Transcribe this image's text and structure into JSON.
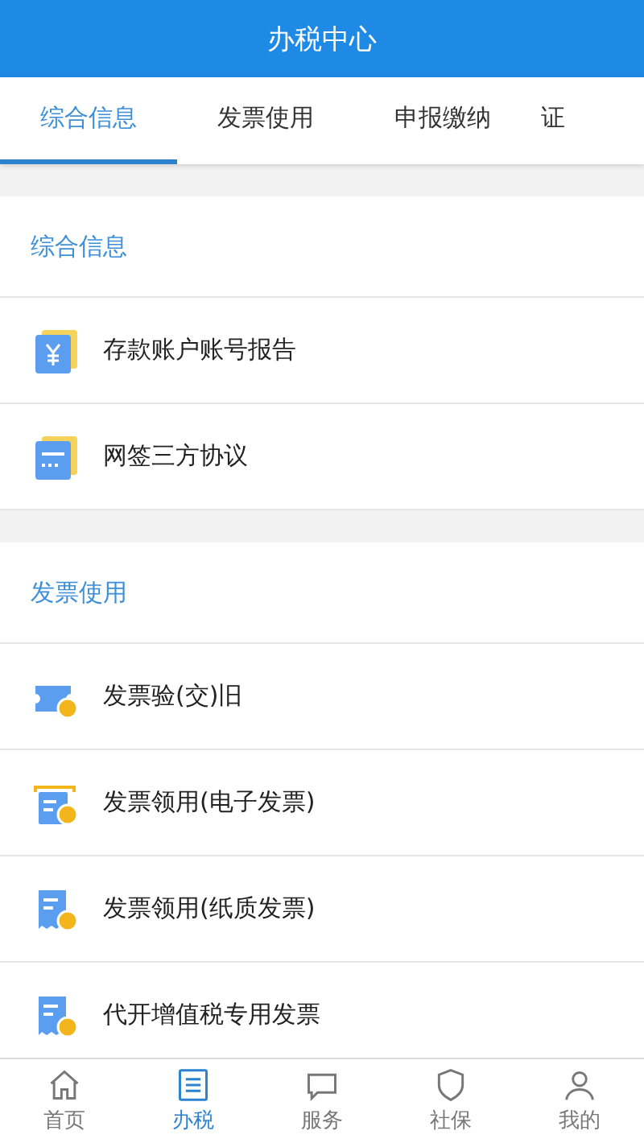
{
  "header": {
    "title": "办税中心"
  },
  "tabs": [
    {
      "label": "综合信息",
      "selected": true
    },
    {
      "label": "发票使用",
      "selected": false
    },
    {
      "label": "申报缴纳",
      "selected": false
    },
    {
      "label": "证",
      "selected": false
    }
  ],
  "sections": [
    {
      "title": "综合信息",
      "items": [
        {
          "label": "存款账户账号报告",
          "kind": "yuan"
        },
        {
          "label": "网签三方协议",
          "kind": "card"
        }
      ]
    },
    {
      "title": "发票使用",
      "items": [
        {
          "label": "发票验(交)旧",
          "kind": "ticket"
        },
        {
          "label": "发票领用(电子发票)",
          "kind": "tray"
        },
        {
          "label": "发票领用(纸质发票)",
          "kind": "doc"
        },
        {
          "label": "代开增值税专用发票",
          "kind": "doc"
        }
      ]
    }
  ],
  "bottom_nav": [
    {
      "label": "首页",
      "kind": "home",
      "selected": false
    },
    {
      "label": "办税",
      "kind": "list",
      "selected": true
    },
    {
      "label": "服务",
      "kind": "service",
      "selected": false
    },
    {
      "label": "社保",
      "kind": "shield",
      "selected": false
    },
    {
      "label": "我的",
      "kind": "person",
      "selected": false
    }
  ]
}
